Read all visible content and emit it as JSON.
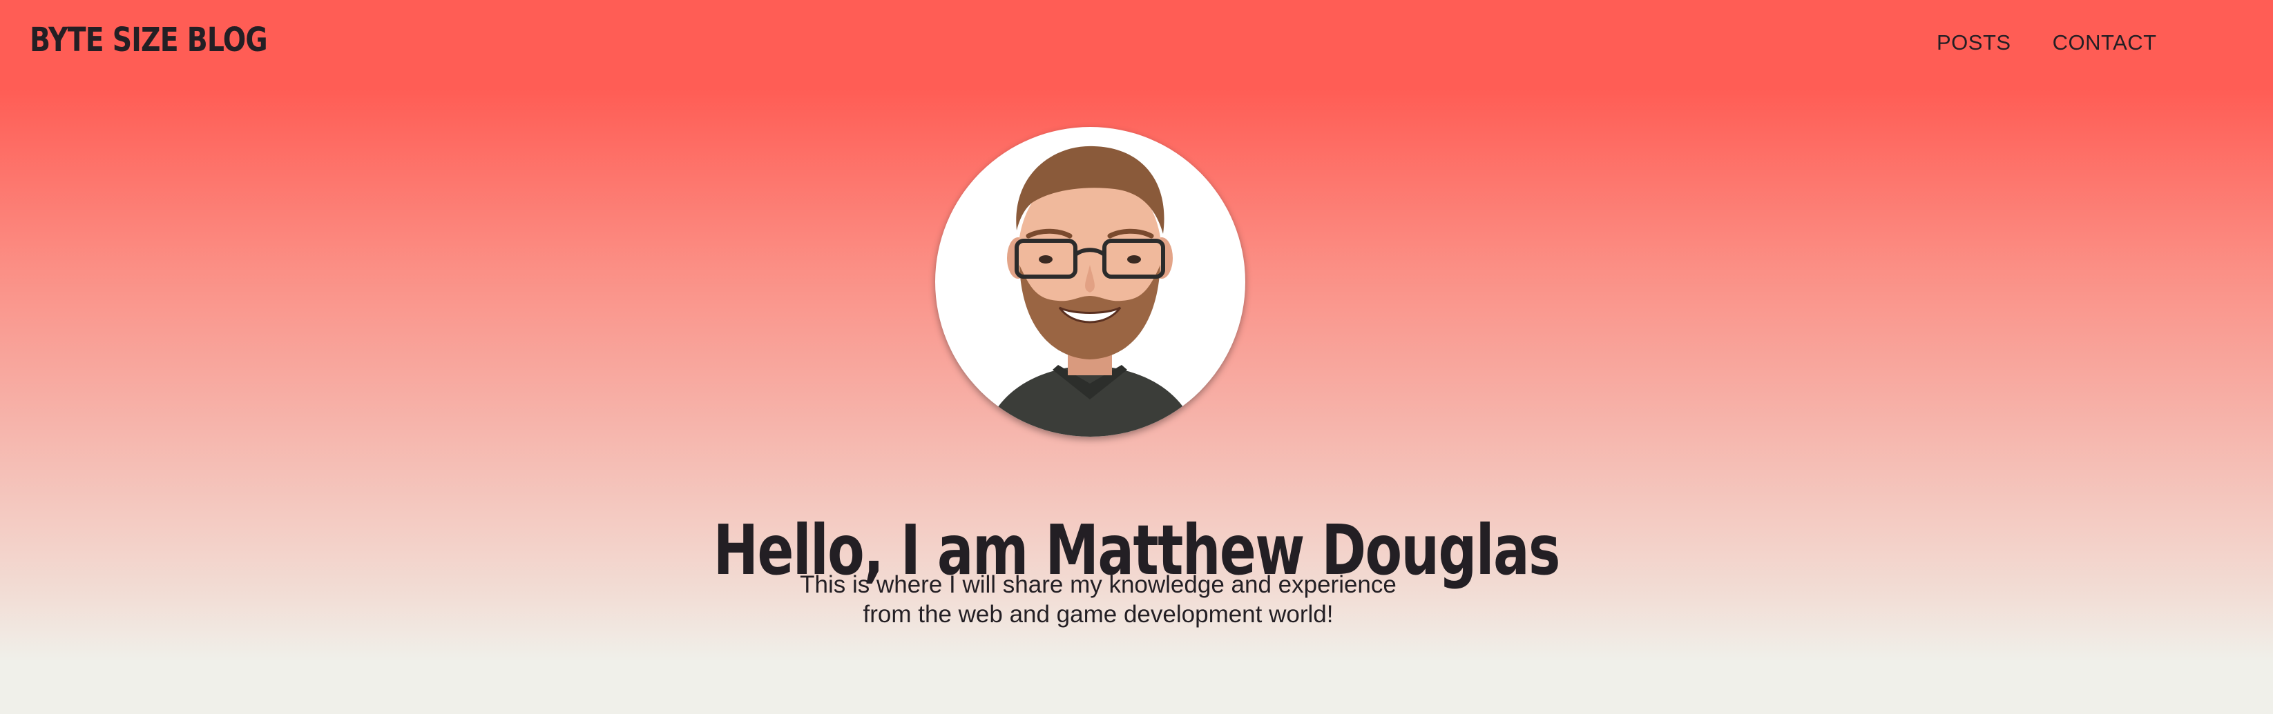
{
  "header": {
    "brand": "BYTE SIZE BLOG",
    "nav": [
      {
        "label": "POSTS"
      },
      {
        "label": "CONTACT"
      }
    ]
  },
  "hero": {
    "avatar_icon": "avatar-portrait",
    "title": "Hello, I am Matthew Douglas",
    "subtitle_line1": "This is where I will share my knowledge and experience",
    "subtitle_line2": "from the web and game development world!"
  },
  "colors": {
    "gradient_top": "#ff5d55",
    "gradient_bottom": "#f0f0ea",
    "text": "#231f24"
  }
}
